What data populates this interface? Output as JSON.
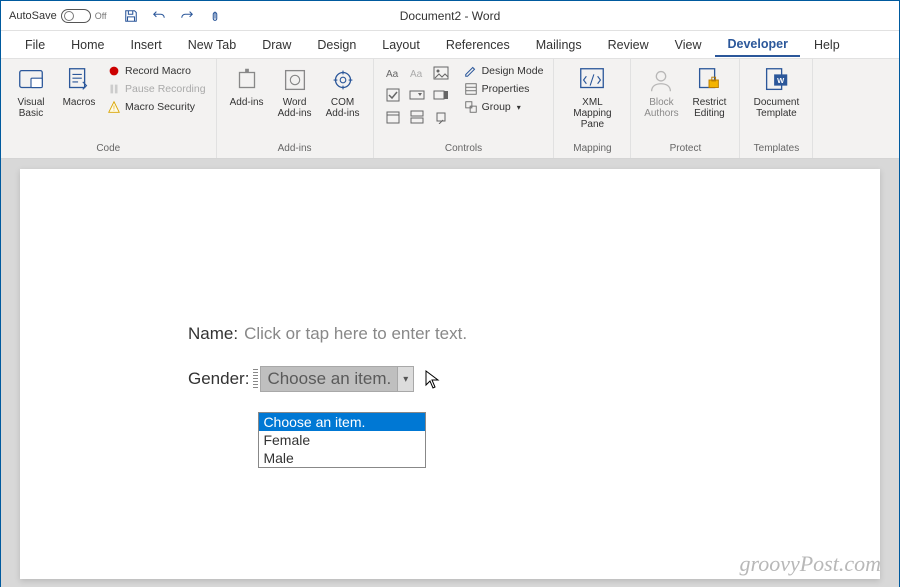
{
  "autosave": {
    "label": "AutoSave",
    "state": "Off"
  },
  "title": "Document2 - Word",
  "tabs": [
    "File",
    "Home",
    "Insert",
    "New Tab",
    "Draw",
    "Design",
    "Layout",
    "References",
    "Mailings",
    "Review",
    "View",
    "Developer",
    "Help"
  ],
  "activeTab": "Developer",
  "groups": {
    "code": {
      "label": "Code",
      "visualBasic": "Visual Basic",
      "macros": "Macros",
      "recordMacro": "Record Macro",
      "pauseRecording": "Pause Recording",
      "macroSecurity": "Macro Security"
    },
    "addins": {
      "label": "Add-ins",
      "addins": "Add-ins",
      "wordAddins": "Word Add-ins",
      "comAddins": "COM Add-ins"
    },
    "controls": {
      "label": "Controls",
      "designMode": "Design Mode",
      "properties": "Properties",
      "group": "Group"
    },
    "mapping": {
      "label": "Mapping",
      "xmlPane": "XML Mapping Pane"
    },
    "protect": {
      "label": "Protect",
      "blockAuthors": "Block Authors",
      "restrictEditing": "Restrict Editing"
    },
    "templates": {
      "label": "Templates",
      "docTemplate": "Document Template"
    }
  },
  "doc": {
    "nameLabel": "Name:",
    "namePlaceholder": "Click or tap here to enter text.",
    "genderLabel": "Gender:",
    "comboValue": "Choose an item.",
    "options": [
      "Choose an item.",
      "Female",
      "Male"
    ]
  },
  "watermark": "groovyPost.com"
}
